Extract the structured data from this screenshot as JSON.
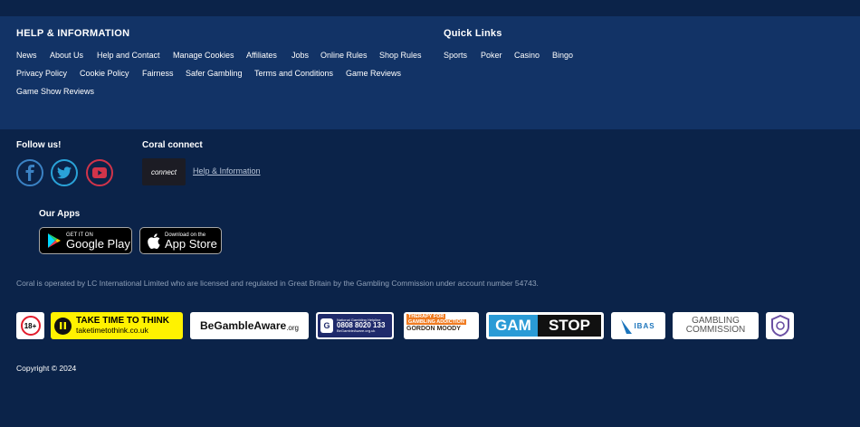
{
  "help_info": {
    "title": "HELP & INFORMATION",
    "row1": [
      "News",
      "About Us",
      "Help and Contact",
      "Manage Cookies",
      "Affiliates",
      "Jobs",
      "Online Rules",
      "Shop Rules"
    ],
    "row2": [
      "Privacy Policy",
      "Cookie Policy",
      "Fairness",
      "Safer Gambling",
      "Terms and Conditions",
      "Game Reviews"
    ],
    "row3": [
      "Game Show Reviews"
    ]
  },
  "quick_links": {
    "title": "Quick Links",
    "items": [
      "Sports",
      "Poker",
      "Casino",
      "Bingo"
    ]
  },
  "follow": {
    "title": "Follow us!",
    "icons": [
      "facebook-icon",
      "twitter-icon",
      "youtube-icon"
    ]
  },
  "coral_connect": {
    "title": "Coral connect",
    "logo_text": "connect",
    "link": "Help & Information"
  },
  "apps": {
    "title": "Our Apps",
    "google_small": "GET IT ON",
    "google_big": "Google Play",
    "apple_small": "Download on the",
    "apple_big": "App Store"
  },
  "disclaimer": "Coral is operated by LC International Limited who are licensed and regulated in Great Britain by the Gambling Commission under account number 54743.",
  "badges": {
    "age": "18+",
    "ttt_main": "TAKE TIME TO THINK",
    "ttt_url": "taketimetothink.co.uk",
    "bga_be": "Be",
    "bga_main": "GambleAware",
    "bga_org": ".org",
    "helpline_title": "National Gambling Helpline",
    "helpline_number": "0808 8020 133",
    "helpline_url": "BeGambleAware.org.uk",
    "gordon_line1": "THERAPY FOR",
    "gordon_line2": "GAMBLING ADDICTION",
    "gordon_line3": "GORDON MOODY",
    "gamstop_gam": "GAM",
    "gamstop_stop": "STOP",
    "ibas": "IBAS",
    "gc_line1": "GAMBLING",
    "gc_line2": "COMMISSION"
  },
  "copyright": "Copyright © 2024",
  "colors": {
    "background": "#0b2349",
    "panel": "#123366",
    "facebook": "#3b82c4",
    "twitter": "#2aa3d8",
    "youtube": "#d1344a",
    "ttt_yellow": "#fff200",
    "gamstop_blue": "#2a9bd6",
    "gordon_orange": "#f07c22"
  }
}
